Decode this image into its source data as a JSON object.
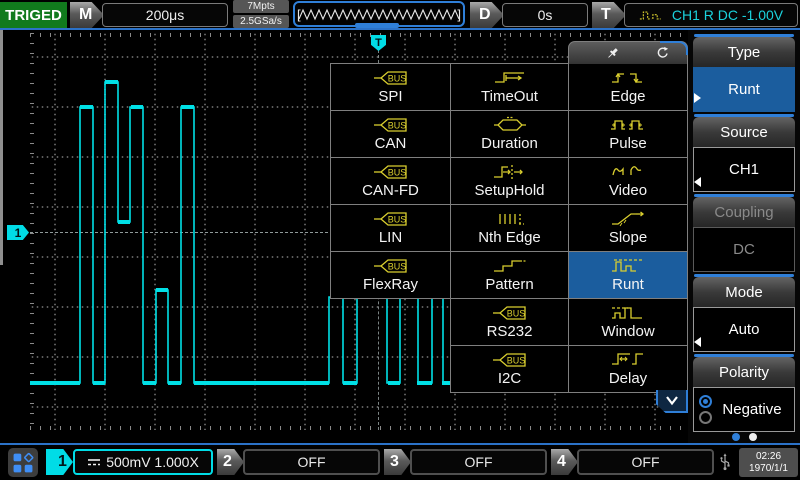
{
  "topbar": {
    "status": "TRIGED",
    "timebase_label": "M",
    "timebase": "200μs",
    "memory_depth": "7Mpts",
    "sample_rate": "2.5GSa/s",
    "delay_label": "D",
    "delay": "0s",
    "trigger_label": "T",
    "trigger_info": "CH1 R DC -1.00V"
  },
  "display": {
    "channel1_marker": "1",
    "trigger_marker": "T"
  },
  "menu": {
    "col1": [
      {
        "label": "SPI",
        "icon": "bus-icon"
      },
      {
        "label": "CAN",
        "icon": "bus-icon"
      },
      {
        "label": "CAN-FD",
        "icon": "bus-icon"
      },
      {
        "label": "LIN",
        "icon": "bus-icon"
      },
      {
        "label": "FlexRay",
        "icon": "bus-icon"
      }
    ],
    "col2": [
      {
        "label": "TimeOut",
        "icon": "timeout-icon"
      },
      {
        "label": "Duration",
        "icon": "duration-icon"
      },
      {
        "label": "SetupHold",
        "icon": "setuphold-icon"
      },
      {
        "label": "Nth Edge",
        "icon": "nth-edge-icon"
      },
      {
        "label": "Pattern",
        "icon": "pattern-icon"
      },
      {
        "label": "RS232",
        "icon": "bus-icon"
      },
      {
        "label": "I2C",
        "icon": "bus-icon"
      }
    ],
    "col3": [
      {
        "label": "Edge",
        "icon": "edge-icon"
      },
      {
        "label": "Pulse",
        "icon": "pulse-icon"
      },
      {
        "label": "Video",
        "icon": "video-icon"
      },
      {
        "label": "Slope",
        "icon": "slope-icon"
      },
      {
        "label": "Runt",
        "icon": "runt-icon",
        "selected": true
      },
      {
        "label": "Window",
        "icon": "window-icon"
      },
      {
        "label": "Delay",
        "icon": "delay-icon"
      }
    ],
    "header_icons": [
      "pin-icon",
      "refresh-icon"
    ]
  },
  "sidebar": {
    "sections": [
      {
        "title": "Type",
        "value": "Runt",
        "selected": true
      },
      {
        "title": "Source",
        "value": "CH1"
      },
      {
        "title": "Coupling",
        "value": "DC",
        "disabled": true
      },
      {
        "title": "Mode",
        "value": "Auto"
      },
      {
        "title": "Polarity",
        "value": "Negative",
        "radio_selected": "first"
      }
    ],
    "page_dots": {
      "count": 2,
      "active": 1
    }
  },
  "bottombar": {
    "channels": [
      {
        "number": "1",
        "value": "500mV 1.000X",
        "active": true,
        "icon": "dc-coupling-icon"
      },
      {
        "number": "2",
        "value": "OFF",
        "active": false
      },
      {
        "number": "3",
        "value": "OFF",
        "active": false
      },
      {
        "number": "4",
        "value": "OFF",
        "active": false
      }
    ],
    "time": "02:26",
    "date": "1970/1/1"
  },
  "colors": {
    "trace_cyan": "#00e0e6",
    "accent_blue": "#2f7fd8",
    "selected_blue": "#1b5d9e",
    "icon_yellow": "#d9ce2f",
    "status_green": "#117a1d"
  }
}
